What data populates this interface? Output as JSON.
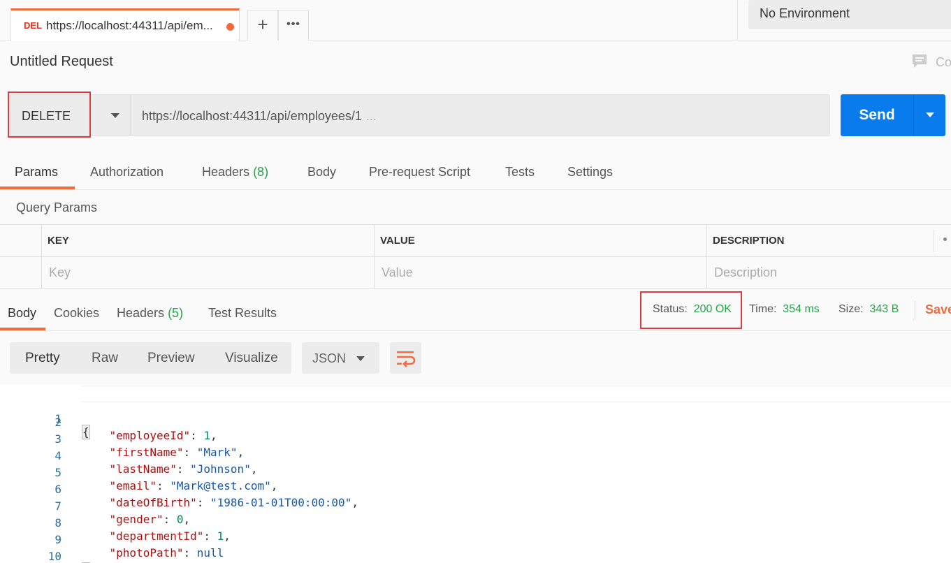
{
  "tab": {
    "method_abbr": "DEL",
    "title": "https://localhost:44311/api/em..."
  },
  "environment": {
    "selected": "No Environment"
  },
  "request": {
    "title": "Untitled Request",
    "comments_label": "Co",
    "method": "DELETE",
    "url": "https://localhost:44311/api/employees/1",
    "url_ellipsis": "...",
    "send_label": "Send"
  },
  "request_tabs": [
    {
      "label": "Params",
      "count": ""
    },
    {
      "label": "Authorization",
      "count": ""
    },
    {
      "label": "Headers",
      "count": "(8)"
    },
    {
      "label": "Body",
      "count": ""
    },
    {
      "label": "Pre-request Script",
      "count": ""
    },
    {
      "label": "Tests",
      "count": ""
    },
    {
      "label": "Settings",
      "count": ""
    }
  ],
  "query_params": {
    "title": "Query Params",
    "columns": [
      "KEY",
      "VALUE",
      "DESCRIPTION"
    ],
    "placeholders": [
      "Key",
      "Value",
      "Description"
    ]
  },
  "response_tabs": [
    {
      "label": "Body",
      "count": ""
    },
    {
      "label": "Cookies",
      "count": ""
    },
    {
      "label": "Headers",
      "count": "(5)"
    },
    {
      "label": "Test Results",
      "count": ""
    }
  ],
  "response_meta": {
    "status_label": "Status:",
    "status_value": "200 OK",
    "time_label": "Time:",
    "time_value": "354 ms",
    "size_label": "Size:",
    "size_value": "343 B",
    "save_label": "Save"
  },
  "body_view": {
    "modes": [
      "Pretty",
      "Raw",
      "Preview",
      "Visualize"
    ],
    "format": "JSON"
  },
  "colors": {
    "accent": "#f26b3a",
    "primary": "#097bed",
    "success": "#26a449",
    "highlight": "#e0393e"
  },
  "code_lines": [
    {
      "n": "1",
      "open": "{"
    },
    {
      "n": "2",
      "key": "\"employeeId\"",
      "val": "1",
      "type": "num",
      "comma": ","
    },
    {
      "n": "3",
      "key": "\"firstName\"",
      "val": "\"Mark\"",
      "type": "str",
      "comma": ","
    },
    {
      "n": "4",
      "key": "\"lastName\"",
      "val": "\"Johnson\"",
      "type": "str",
      "comma": ","
    },
    {
      "n": "5",
      "key": "\"email\"",
      "val": "\"Mark@test.com\"",
      "type": "str",
      "comma": ","
    },
    {
      "n": "6",
      "key": "\"dateOfBirth\"",
      "val": "\"1986-01-01T00:00:00\"",
      "type": "str",
      "comma": ","
    },
    {
      "n": "7",
      "key": "\"gender\"",
      "val": "0",
      "type": "num",
      "comma": ","
    },
    {
      "n": "8",
      "key": "\"departmentId\"",
      "val": "1",
      "type": "num",
      "comma": ","
    },
    {
      "n": "9",
      "key": "\"photoPath\"",
      "val": "null",
      "type": "str",
      "comma": ""
    },
    {
      "n": "10",
      "open": "}"
    }
  ]
}
